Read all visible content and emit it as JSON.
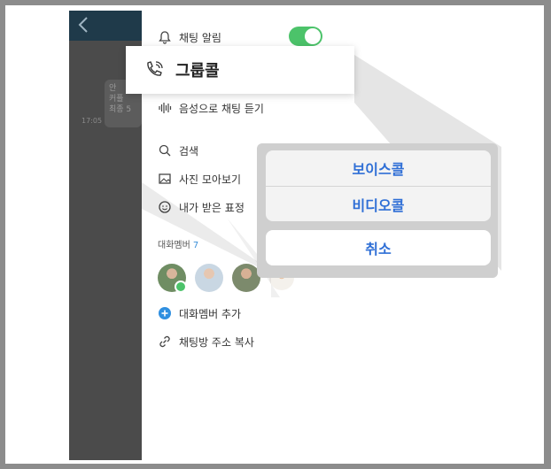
{
  "chat": {
    "back_icon": "chevron-left-icon",
    "bubble_text": "안\n커플\n최종 5",
    "bubble_time": "17:05"
  },
  "menu": {
    "notification_label": "채팅 알림",
    "notification_on": true,
    "voice_label": "음성으로 채팅 듣기",
    "search_label": "검색",
    "photos_label": "사진 모아보기",
    "emoji_label": "내가 받은 표정",
    "members_label": "대화멤버",
    "members_count": "7",
    "add_member_label": "대화멤버 추가",
    "copy_link_label": "채팅방 주소 복사"
  },
  "group_call": {
    "title": "그룹콜",
    "icon": "phone-call-icon"
  },
  "action_sheet": {
    "voice_call": "보이스콜",
    "video_call": "비디오콜",
    "cancel": "취소"
  },
  "colors": {
    "toggle_on": "#4cc36a",
    "accent_blue": "#2f6fd6",
    "header": "#1f3a4a"
  }
}
